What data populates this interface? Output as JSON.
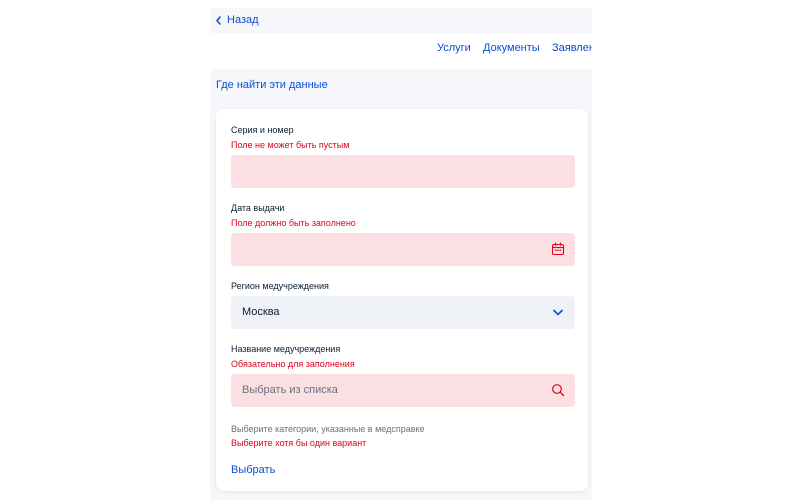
{
  "header": {
    "back_label": "Назад",
    "nav": [
      "Услуги",
      "Документы",
      "Заявлен"
    ]
  },
  "where_link": "Где найти эти данные",
  "form": {
    "series_number": {
      "label": "Серия и номер",
      "error": "Поле не может быть пустым",
      "value": ""
    },
    "issue_date": {
      "label": "Дата выдачи",
      "error": "Поле должно быть заполнено",
      "value": ""
    },
    "region": {
      "label": "Регион медучреждения",
      "value": "Москва"
    },
    "institution": {
      "label": "Название медучреждения",
      "error": "Обязательно для заполнения",
      "placeholder": "Выбрать из списка"
    },
    "categories": {
      "hint": "Выберите категории, указанные в медсправке",
      "error": "Выберите хотя бы один вариант",
      "action": "Выбрать"
    }
  },
  "colors": {
    "link": "#0d4cd3",
    "error": "#e1001e",
    "invalid_bg": "#fcdfe2",
    "input_bg": "#eef2f7",
    "page_bg": "#f5f7fa"
  }
}
